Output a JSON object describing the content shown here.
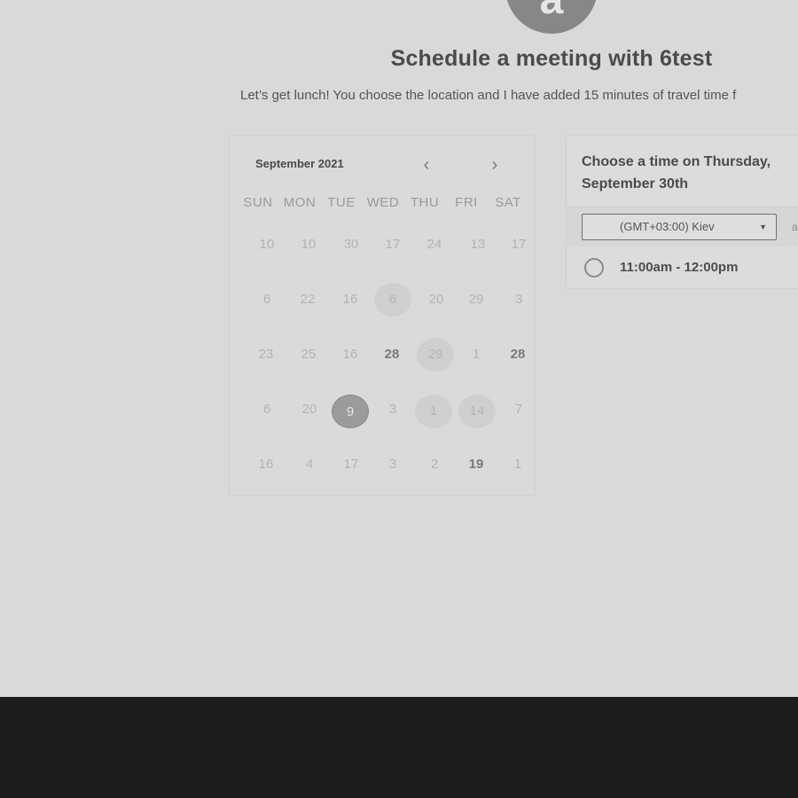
{
  "avatar": {
    "letter": "a"
  },
  "page": {
    "title": "Schedule a meeting with 6test",
    "subtitle": "Let’s get lunch! You choose the location and I have added 15 minutes of travel time f"
  },
  "calendar": {
    "month": "September 2021",
    "prev_icon": "chevron-left-icon",
    "next_icon": "chevron-right-icon",
    "prev_glyph": "‹",
    "next_glyph": "›",
    "weekdays": [
      "SUN",
      "MON",
      "TUE",
      "WED",
      "THU",
      "FRI",
      "SAT"
    ],
    "weeks": [
      [
        "10",
        "10",
        "30",
        "17",
        "24",
        "13",
        "17"
      ],
      [
        "6",
        "22",
        "16",
        "6",
        "20",
        "29",
        "3"
      ],
      [
        "23",
        "25",
        "16",
        "28",
        "29",
        "1",
        "28"
      ],
      [
        "6",
        "20",
        "9",
        "3",
        "1",
        "14",
        "7"
      ],
      [
        "16",
        "4",
        "17",
        "3",
        "2",
        "19",
        "1"
      ]
    ],
    "selected_day": "9"
  },
  "times": {
    "title": "Choose a time on Thursday, September 30th",
    "timezone": "(GMT+03:00) Kiev",
    "timezone_extra": "a",
    "caret_glyph": "▼",
    "slots": [
      "11:00am - 12:00pm"
    ]
  },
  "colors": {
    "background": "#d9d9d9",
    "footer": "#1c1c1c",
    "selected": "#9b9b9b"
  }
}
